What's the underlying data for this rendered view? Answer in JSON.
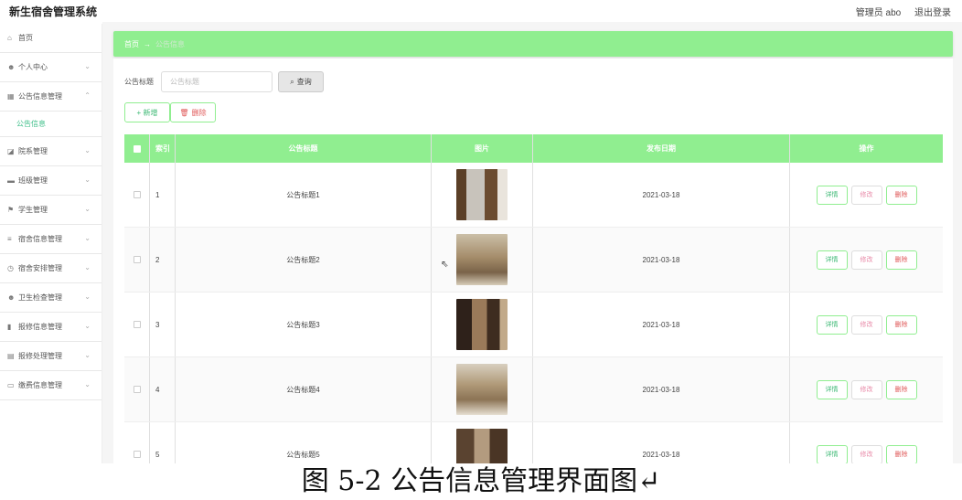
{
  "header": {
    "app_title": "新生宿舍管理系统",
    "admin_label": "管理员 abo",
    "logout_label": "退出登录"
  },
  "sidebar": {
    "items": [
      {
        "label": "首页",
        "icon": "home-icon",
        "glyph": "⌂"
      },
      {
        "label": "个人中心",
        "icon": "user-icon",
        "glyph": "☻"
      },
      {
        "label": "公告信息管理",
        "icon": "grid-icon",
        "glyph": "▦"
      },
      {
        "label": "院系管理",
        "icon": "chart-icon",
        "glyph": "◪"
      },
      {
        "label": "班级管理",
        "icon": "card-icon",
        "glyph": "▬"
      },
      {
        "label": "学生管理",
        "icon": "flag-icon",
        "glyph": "⚑"
      },
      {
        "label": "宿舍信息管理",
        "icon": "list-icon",
        "glyph": "≡"
      },
      {
        "label": "宿舍安排管理",
        "icon": "clock-icon",
        "glyph": "◷"
      },
      {
        "label": "卫生检查管理",
        "icon": "person-icon",
        "glyph": "☻"
      },
      {
        "label": "报修信息管理",
        "icon": "bar-chart-icon",
        "glyph": "▮"
      },
      {
        "label": "报修处理管理",
        "icon": "doc-icon",
        "glyph": "▤"
      },
      {
        "label": "缴费信息管理",
        "icon": "message-icon",
        "glyph": "▭"
      }
    ],
    "sub_item": "公告信息"
  },
  "breadcrumb": {
    "home": "首页",
    "arrow": "→",
    "current": "公告信息"
  },
  "search": {
    "label": "公告标题",
    "placeholder": "公告标题",
    "button": "查询",
    "button_icon": "search-icon"
  },
  "actions": {
    "add": "+ 新增",
    "delete": "删除"
  },
  "table": {
    "headers": {
      "index": "索引",
      "title": "公告标题",
      "image": "图片",
      "date": "发布日期",
      "ops": "操作"
    },
    "rows": [
      {
        "index": "1",
        "title": "公告标题1",
        "date": "2021-03-18"
      },
      {
        "index": "2",
        "title": "公告标题2",
        "date": "2021-03-18"
      },
      {
        "index": "3",
        "title": "公告标题3",
        "date": "2021-03-18"
      },
      {
        "index": "4",
        "title": "公告标题4",
        "date": "2021-03-18"
      },
      {
        "index": "5",
        "title": "公告标题5",
        "date": "2021-03-18"
      }
    ],
    "op_labels": {
      "detail": "详情",
      "edit": "修改",
      "delete": "删除"
    }
  },
  "caption": "图 5-2 公告信息管理界面图↵",
  "colors": {
    "accent": "#90ee90",
    "danger": "#e05a5a"
  }
}
